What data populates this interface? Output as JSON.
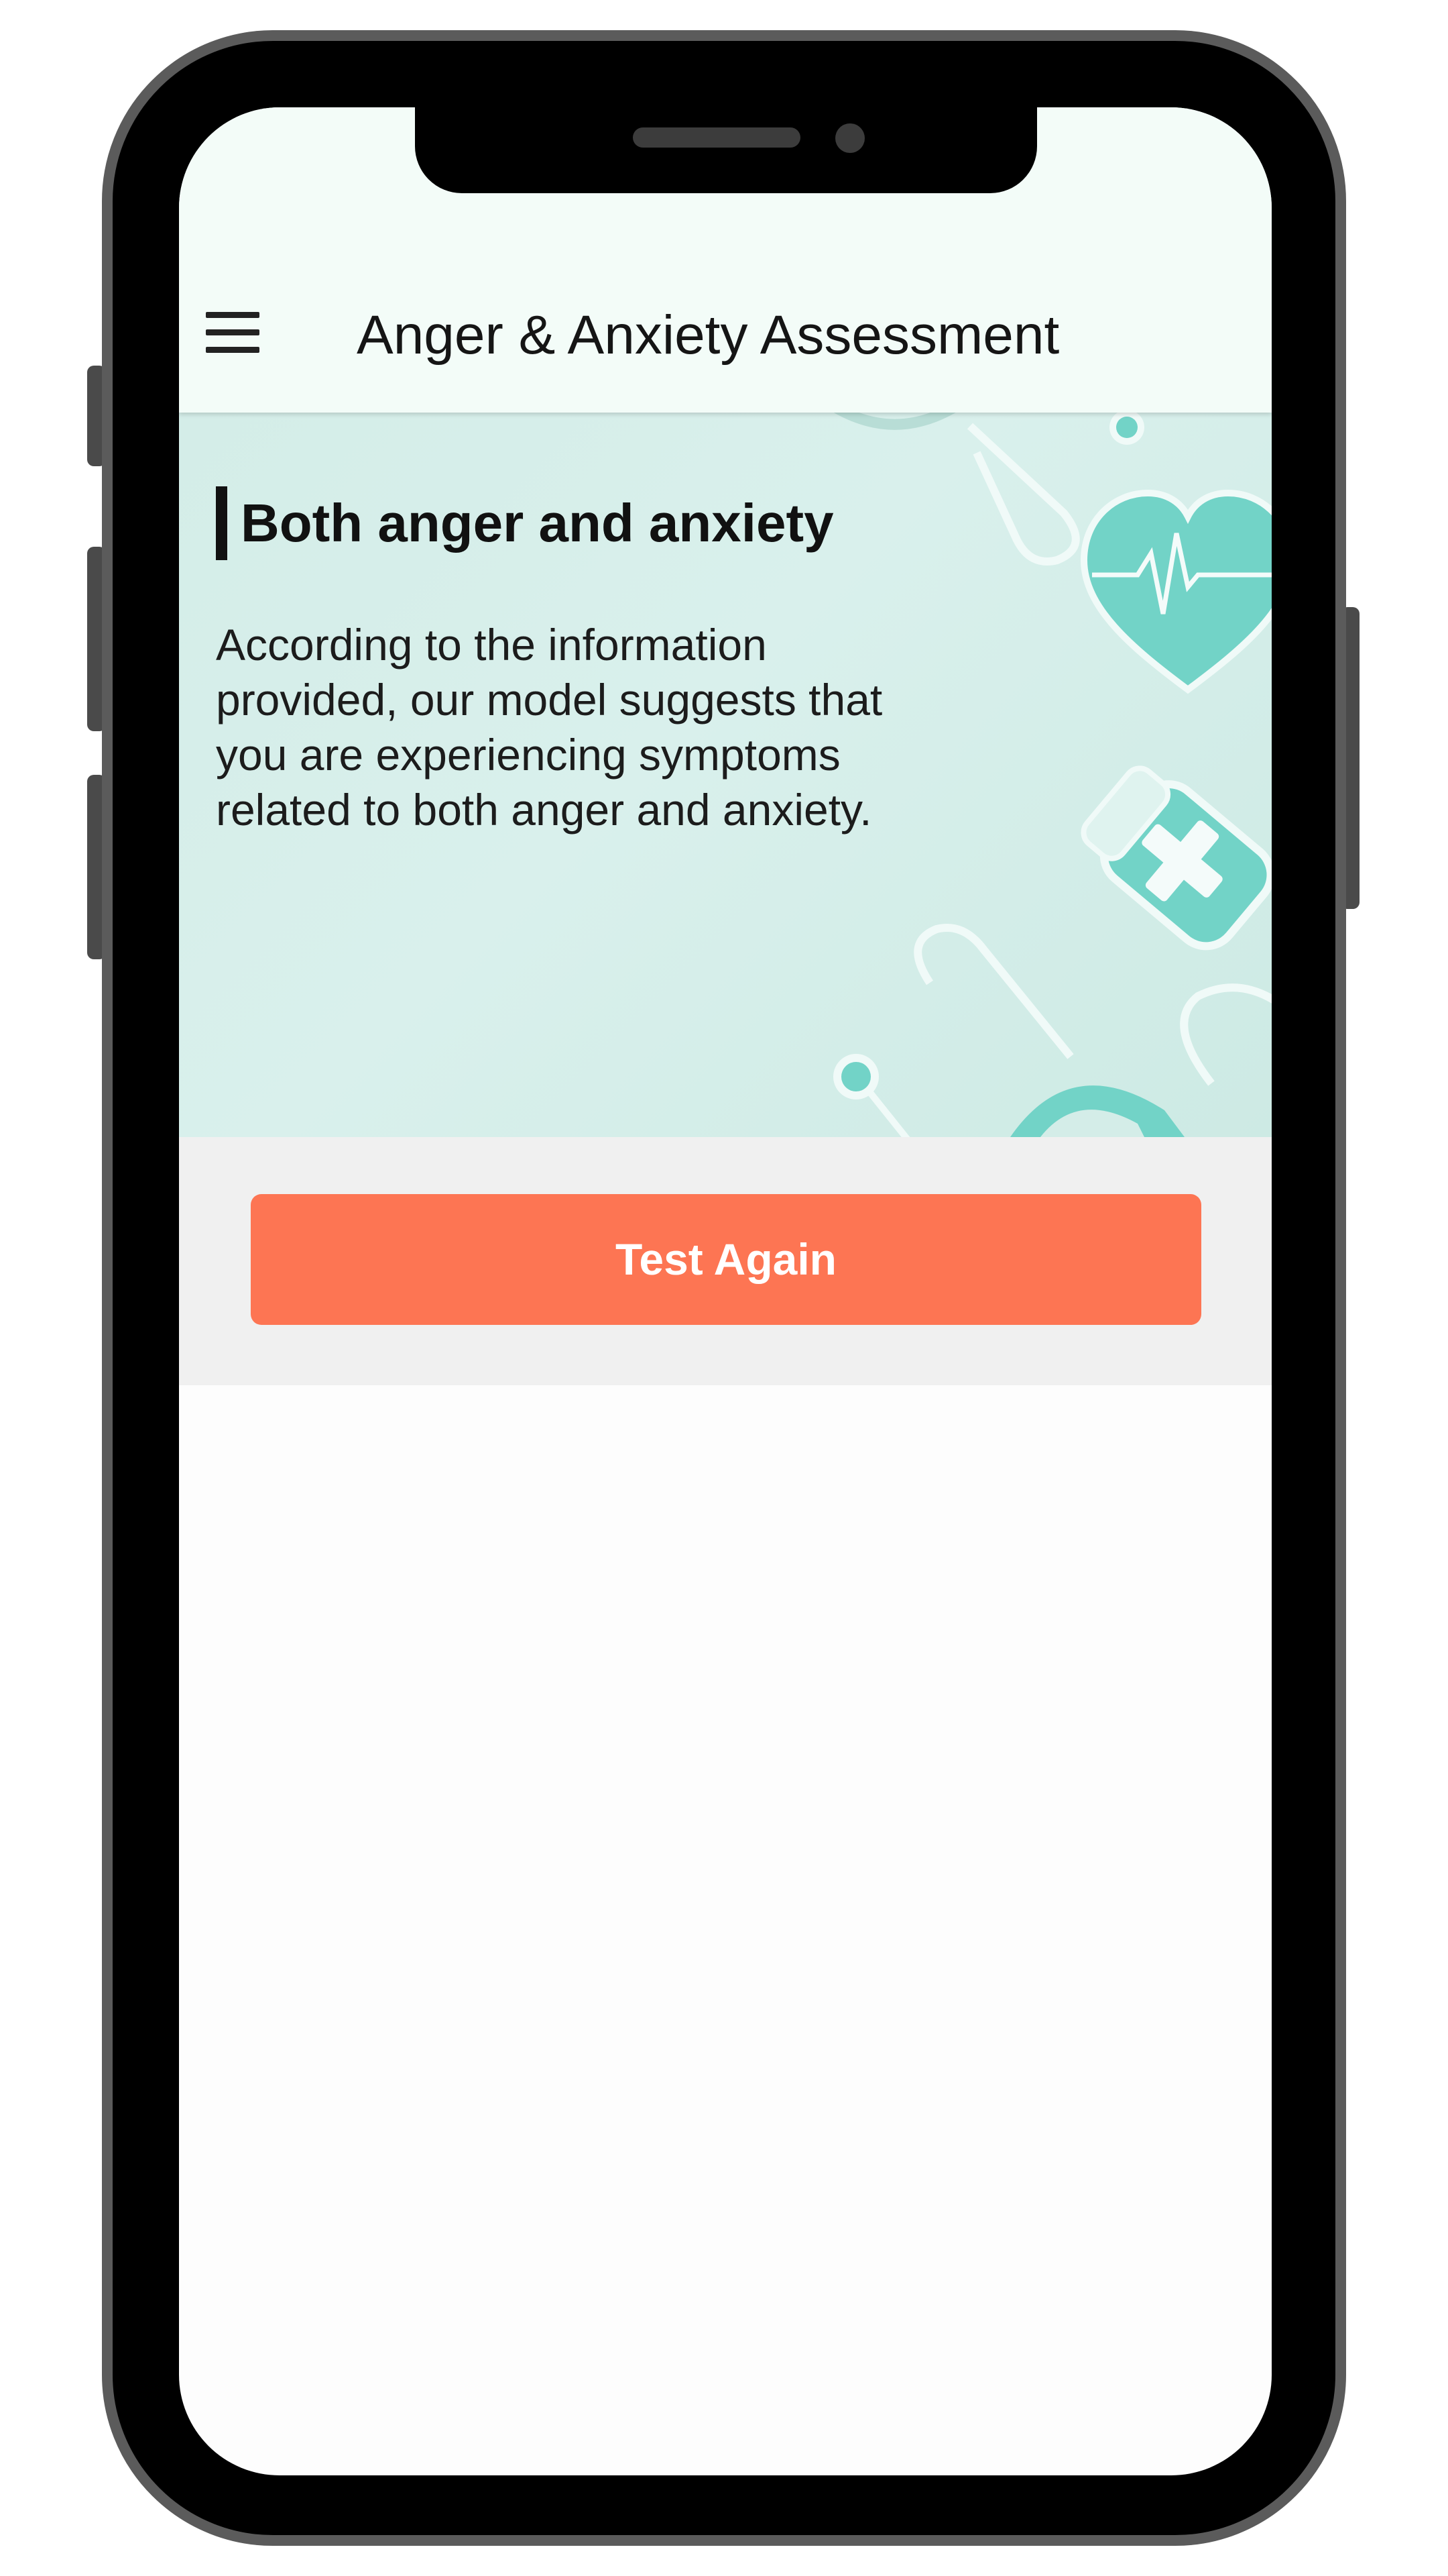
{
  "app_bar": {
    "menu_icon": "hamburger-menu-icon",
    "title": "Anger & Anxiety Assessment",
    "background": "#f3fcf8"
  },
  "result": {
    "title": "Both anger and anxiety",
    "description": "According to the information provided, our model suggests that you are experiencing symptoms related to both anger and anxiety.",
    "decorations": [
      "stethoscope-icon",
      "heart-pulse-icon",
      "medicine-bottle-icon",
      "stethoscope-icon"
    ]
  },
  "actions": {
    "test_again_label": "Test Again"
  },
  "colors": {
    "accent": "#fd7553",
    "hero_background": "#d4ede8",
    "decoration_teal": "#72d3c7",
    "text": "#151515"
  }
}
